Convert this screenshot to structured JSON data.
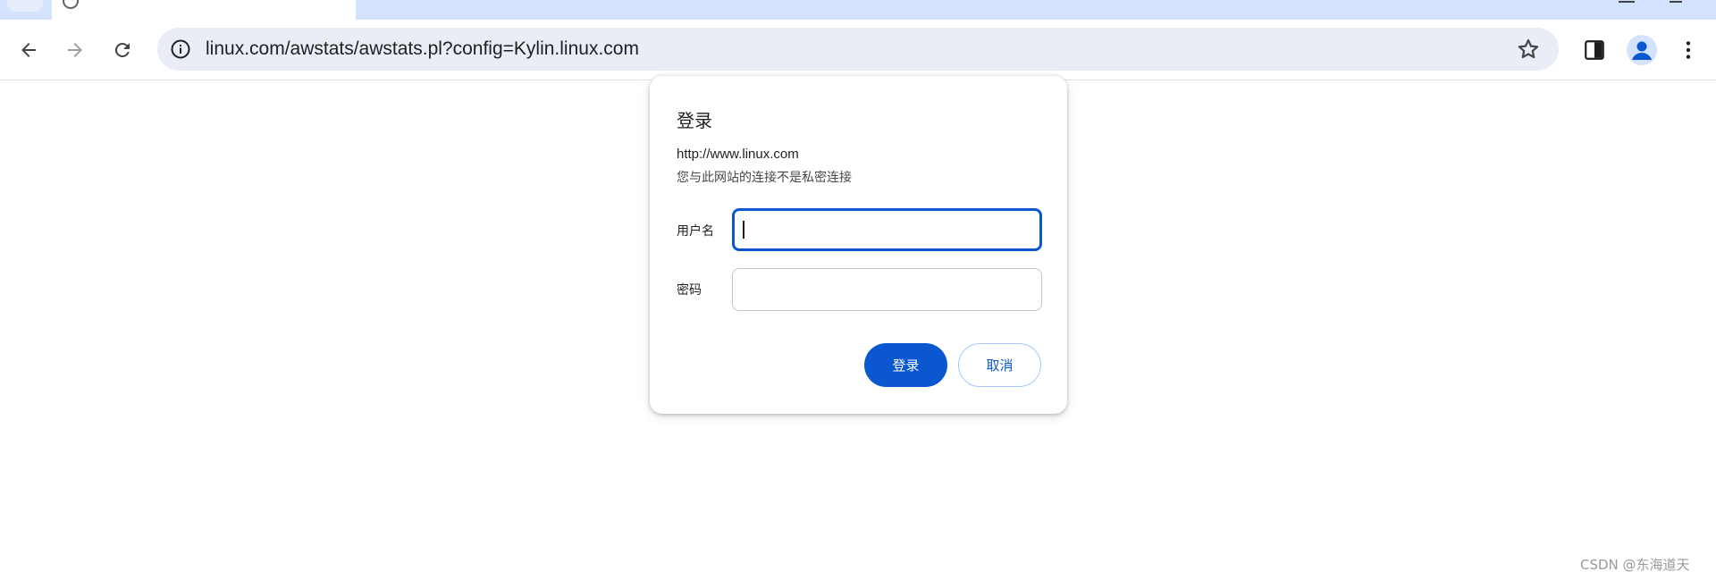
{
  "browser": {
    "address_bar": {
      "url": "linux.com/awstats/awstats.pl?config=Kylin.linux.com"
    }
  },
  "icons": {
    "back": "arrow-left-icon",
    "forward": "arrow-right-icon",
    "reload": "reload-icon",
    "site_info": "info-icon",
    "bookmark": "star-icon",
    "side_panel": "side-panel-icon",
    "profile": "profile-icon",
    "menu": "kebab-menu-icon"
  },
  "login_dialog": {
    "title": "登录",
    "origin": "http://www.linux.com",
    "warning": "您与此网站的连接不是私密连接",
    "username_label": "用户名",
    "username_value": "",
    "password_label": "密码",
    "password_value": "",
    "submit_label": "登录",
    "cancel_label": "取消"
  },
  "watermark": {
    "text": "CSDN @东海道天"
  },
  "colors": {
    "tabstrip": "#d3e3fd",
    "omnibox": "#e9eef6",
    "accent": "#0b57d0",
    "secondary_border": "#a8c7fa"
  }
}
